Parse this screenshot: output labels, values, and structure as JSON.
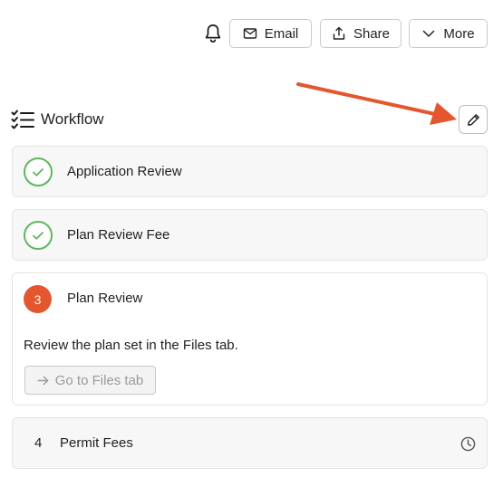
{
  "toolbar": {
    "email_label": "Email",
    "share_label": "Share",
    "more_label": "More"
  },
  "workflow": {
    "title": "Workflow",
    "steps": [
      {
        "label": "Application Review",
        "status": "complete"
      },
      {
        "label": "Plan Review Fee",
        "status": "complete"
      },
      {
        "number": "3",
        "label": "Plan Review",
        "status": "current",
        "description": "Review the plan set in the Files tab.",
        "action_label": "Go to Files tab"
      },
      {
        "number": "4",
        "label": "Permit Fees",
        "status": "pending"
      }
    ]
  },
  "colors": {
    "complete": "#5cb85c",
    "current": "#e4572e",
    "annotation_arrow": "#e4572e"
  },
  "icons": {
    "notifications": "bell-icon",
    "email": "envelope-icon",
    "share": "share-icon",
    "more": "chevron-down-icon",
    "workflow": "checklist-icon",
    "edit": "pencil-icon",
    "complete": "check-icon",
    "action": "arrow-right-icon",
    "pending": "clock-icon"
  }
}
